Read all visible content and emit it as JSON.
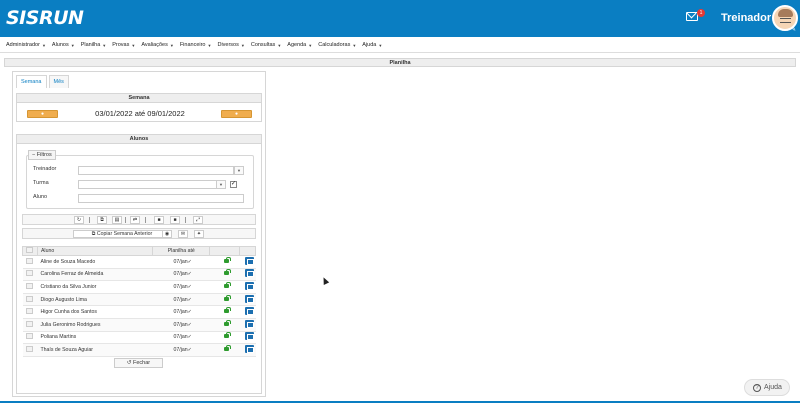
{
  "header": {
    "logo": "SISRUN",
    "notification_count": "1",
    "username": "Treinador"
  },
  "menu": {
    "items": [
      "Administrador",
      "Alunos",
      "Planilha",
      "Provas",
      "Avaliações",
      "Financeiro",
      "Diversos",
      "Consultas",
      "Agenda",
      "Calculadoras",
      "Ajuda"
    ]
  },
  "panel": {
    "title": "Planilha"
  },
  "tabs": [
    "Semana",
    "Mês"
  ],
  "semana": {
    "title": "Semana",
    "range": "03/01/2022 até 09/01/2022"
  },
  "alunos": {
    "title": "Alunos",
    "filters": {
      "toggle_label": "Filtros",
      "treinador_label": "Treinador",
      "treinador_value": "",
      "turma_label": "Turma",
      "turma_value": "",
      "aluno_label": "Aluno",
      "aluno_value": ""
    },
    "copy_button": "Copiar Semana Anterior",
    "columns": [
      "Aluno",
      "Planilha até"
    ],
    "rows": [
      {
        "name": "Aline de Souza Macedo",
        "until": "07/jan"
      },
      {
        "name": "Carolina Ferraz de Almeida",
        "until": "07/jan"
      },
      {
        "name": "Cristiano da Silva Junior",
        "until": "07/jan"
      },
      {
        "name": "Diogo Augusto Lima",
        "until": "07/jan"
      },
      {
        "name": "Higor Cunha dos Santos",
        "until": "07/jan"
      },
      {
        "name": "Julia Geronimo Rodrigues",
        "until": "07/jan"
      },
      {
        "name": "Poliana Martins",
        "until": "07/jan"
      },
      {
        "name": "Thaís de Souza Aguiar",
        "until": "07/jan"
      }
    ],
    "close_button": "Fechar"
  },
  "help": {
    "label": "Ajuda"
  }
}
